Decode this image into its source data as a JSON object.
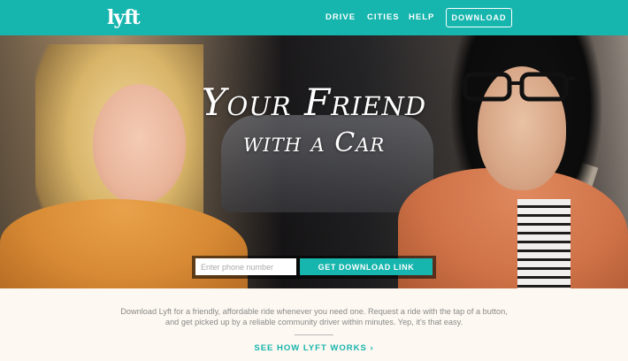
{
  "brand": {
    "logo_text": "lyft",
    "color": "#16b5ad"
  },
  "nav": {
    "links": [
      "DRIVE",
      "CITIES",
      "HELP"
    ],
    "download_label": "DOWNLOAD"
  },
  "hero": {
    "headline_line1": "Your Friend",
    "headline_line2": "with a Car",
    "phone_placeholder": "Enter phone number",
    "cta_label": "GET DOWNLOAD LINK"
  },
  "info": {
    "line1": "Download Lyft for a friendly, affordable ride whenever you need one. Request a ride with the tap of a button,",
    "line2": "and get picked up by a reliable community driver within minutes. Yep, it's that easy.",
    "how_link": "SEE HOW LYFT WORKS ›"
  }
}
